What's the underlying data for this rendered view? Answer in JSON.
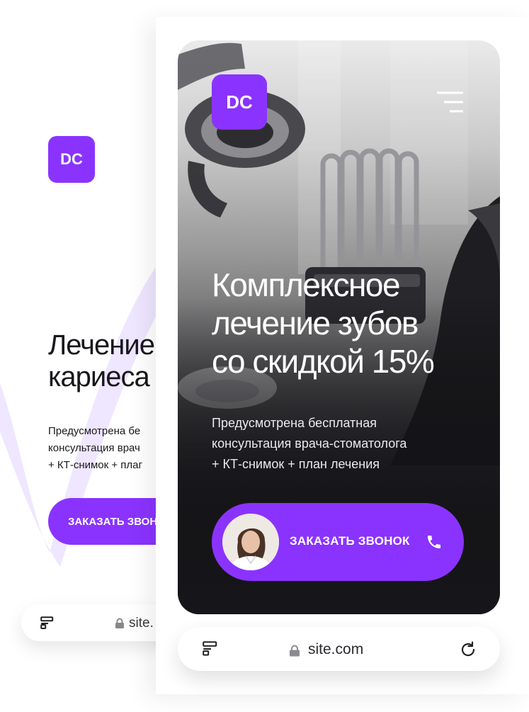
{
  "colors": {
    "accent": "#8a33ff",
    "text_dark": "#17171c",
    "hero_bg": "#17171b"
  },
  "background_screen": {
    "logo": "DC",
    "headline": "Лечение\nкариеса",
    "subtitle": "Предусмотрена бе\nконсультация врач\n+ КТ-снимок + плаг",
    "button_label": "ЗАКАЗАТЬ ЗВОН",
    "address_bar": {
      "url": "site.",
      "tabs_icon": "tabs-icon",
      "lock_icon": "lock-icon"
    }
  },
  "phone": {
    "logo": "DC",
    "menu_icon": "hamburger-menu-icon",
    "hero": {
      "title": "Комплексное\nлечение зубов\nсо скидкой 15%",
      "subtitle": "Предусмотрена бесплатная\nконсультация врача-стоматолога\n+ КТ-снимок + план лечения"
    },
    "cta": {
      "label": "ЗАКАЗАТЬ ЗВОНОК",
      "icon": "phone-icon",
      "avatar": "doctor-avatar"
    },
    "address_bar": {
      "url": "site.com",
      "tabs_icon": "tabs-icon",
      "lock_icon": "lock-icon",
      "reload_icon": "reload-icon"
    }
  }
}
